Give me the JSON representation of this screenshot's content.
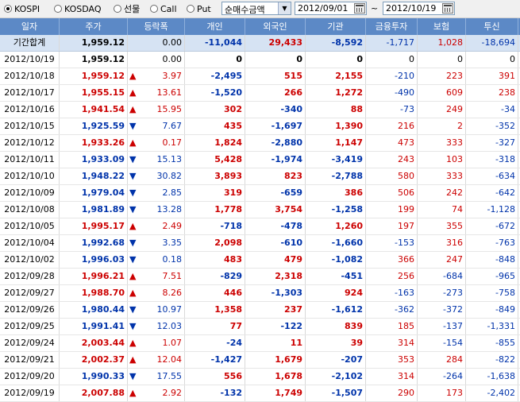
{
  "toolbar": {
    "radios": [
      {
        "label": "KOSPI",
        "checked": true
      },
      {
        "label": "KOSDAQ",
        "checked": false
      },
      {
        "label": "선물",
        "checked": false
      },
      {
        "label": "Call",
        "checked": false
      },
      {
        "label": "Put",
        "checked": false
      }
    ],
    "select_value": "순매수금액",
    "date_from": "2012/09/01",
    "date_tilde": "~",
    "date_to": "2012/10/19"
  },
  "table": {
    "columns": [
      "일자",
      "주가",
      "등락폭",
      "개인",
      "외국인",
      "기관",
      "금융투자",
      "보험",
      "투신"
    ],
    "total": {
      "date": "기간합계",
      "price": "1,959.12",
      "change": "0.00",
      "dir": "flat",
      "indiv": "-11,044",
      "foreign": "29,433",
      "inst": "-8,592",
      "fin": "-1,717",
      "ins": "1,028",
      "trust": "-18,694"
    },
    "rows": [
      {
        "date": "2012/10/19",
        "price": "1,959.12",
        "change": "0.00",
        "dir": "flat",
        "indiv": "0",
        "foreign": "0",
        "inst": "0",
        "fin": "0",
        "ins": "0",
        "trust": "0"
      },
      {
        "date": "2012/10/18",
        "price": "1,959.12",
        "change": "3.97",
        "dir": "up",
        "indiv": "-2,495",
        "foreign": "515",
        "inst": "2,155",
        "fin": "-210",
        "ins": "223",
        "trust": "391"
      },
      {
        "date": "2012/10/17",
        "price": "1,955.15",
        "change": "13.61",
        "dir": "up",
        "indiv": "-1,520",
        "foreign": "266",
        "inst": "1,272",
        "fin": "-490",
        "ins": "609",
        "trust": "238"
      },
      {
        "date": "2012/10/16",
        "price": "1,941.54",
        "change": "15.95",
        "dir": "up",
        "indiv": "302",
        "foreign": "-340",
        "inst": "88",
        "fin": "-73",
        "ins": "249",
        "trust": "-34"
      },
      {
        "date": "2012/10/15",
        "price": "1,925.59",
        "change": "7.67",
        "dir": "down",
        "indiv": "435",
        "foreign": "-1,697",
        "inst": "1,390",
        "fin": "216",
        "ins": "2",
        "trust": "-352"
      },
      {
        "date": "2012/10/12",
        "price": "1,933.26",
        "change": "0.17",
        "dir": "up",
        "indiv": "1,824",
        "foreign": "-2,880",
        "inst": "1,147",
        "fin": "473",
        "ins": "333",
        "trust": "-327"
      },
      {
        "date": "2012/10/11",
        "price": "1,933.09",
        "change": "15.13",
        "dir": "down",
        "indiv": "5,428",
        "foreign": "-1,974",
        "inst": "-3,419",
        "fin": "243",
        "ins": "103",
        "trust": "-318"
      },
      {
        "date": "2012/10/10",
        "price": "1,948.22",
        "change": "30.82",
        "dir": "down",
        "indiv": "3,893",
        "foreign": "823",
        "inst": "-2,788",
        "fin": "580",
        "ins": "333",
        "trust": "-634"
      },
      {
        "date": "2012/10/09",
        "price": "1,979.04",
        "change": "2.85",
        "dir": "down",
        "indiv": "319",
        "foreign": "-659",
        "inst": "386",
        "fin": "506",
        "ins": "242",
        "trust": "-642"
      },
      {
        "date": "2012/10/08",
        "price": "1,981.89",
        "change": "13.28",
        "dir": "down",
        "indiv": "1,778",
        "foreign": "3,754",
        "inst": "-1,258",
        "fin": "199",
        "ins": "74",
        "trust": "-1,128"
      },
      {
        "date": "2012/10/05",
        "price": "1,995.17",
        "change": "2.49",
        "dir": "up",
        "indiv": "-718",
        "foreign": "-478",
        "inst": "1,260",
        "fin": "197",
        "ins": "355",
        "trust": "-672"
      },
      {
        "date": "2012/10/04",
        "price": "1,992.68",
        "change": "3.35",
        "dir": "down",
        "indiv": "2,098",
        "foreign": "-610",
        "inst": "-1,660",
        "fin": "-153",
        "ins": "316",
        "trust": "-763"
      },
      {
        "date": "2012/10/02",
        "price": "1,996.03",
        "change": "0.18",
        "dir": "down",
        "indiv": "483",
        "foreign": "479",
        "inst": "-1,082",
        "fin": "366",
        "ins": "247",
        "trust": "-848"
      },
      {
        "date": "2012/09/28",
        "price": "1,996.21",
        "change": "7.51",
        "dir": "up",
        "indiv": "-829",
        "foreign": "2,318",
        "inst": "-451",
        "fin": "256",
        "ins": "-684",
        "trust": "-965"
      },
      {
        "date": "2012/09/27",
        "price": "1,988.70",
        "change": "8.26",
        "dir": "up",
        "indiv": "446",
        "foreign": "-1,303",
        "inst": "924",
        "fin": "-163",
        "ins": "-273",
        "trust": "-758"
      },
      {
        "date": "2012/09/26",
        "price": "1,980.44",
        "change": "10.97",
        "dir": "down",
        "indiv": "1,358",
        "foreign": "237",
        "inst": "-1,612",
        "fin": "-362",
        "ins": "-372",
        "trust": "-849"
      },
      {
        "date": "2012/09/25",
        "price": "1,991.41",
        "change": "12.03",
        "dir": "down",
        "indiv": "77",
        "foreign": "-122",
        "inst": "839",
        "fin": "185",
        "ins": "-137",
        "trust": "-1,331"
      },
      {
        "date": "2012/09/24",
        "price": "2,003.44",
        "change": "1.07",
        "dir": "up",
        "indiv": "-24",
        "foreign": "11",
        "inst": "39",
        "fin": "314",
        "ins": "-154",
        "trust": "-855"
      },
      {
        "date": "2012/09/21",
        "price": "2,002.37",
        "change": "12.04",
        "dir": "up",
        "indiv": "-1,427",
        "foreign": "1,679",
        "inst": "-207",
        "fin": "353",
        "ins": "284",
        "trust": "-822"
      },
      {
        "date": "2012/09/20",
        "price": "1,990.33",
        "change": "17.55",
        "dir": "down",
        "indiv": "556",
        "foreign": "1,678",
        "inst": "-2,102",
        "fin": "314",
        "ins": "-264",
        "trust": "-1,638"
      },
      {
        "date": "2012/09/19",
        "price": "2,007.88",
        "change": "2.92",
        "dir": "up",
        "indiv": "-132",
        "foreign": "1,749",
        "inst": "-1,507",
        "fin": "290",
        "ins": "173",
        "trust": "-2,402"
      }
    ]
  },
  "colors": {
    "up": "#cc0000",
    "down": "#0033aa",
    "header": "#5c89c6",
    "total_row": "#d6e3f3"
  },
  "icons": {
    "up": "▲",
    "down": "▼",
    "select": "dropdown-arrow-icon",
    "calendar": "calendar-icon"
  }
}
